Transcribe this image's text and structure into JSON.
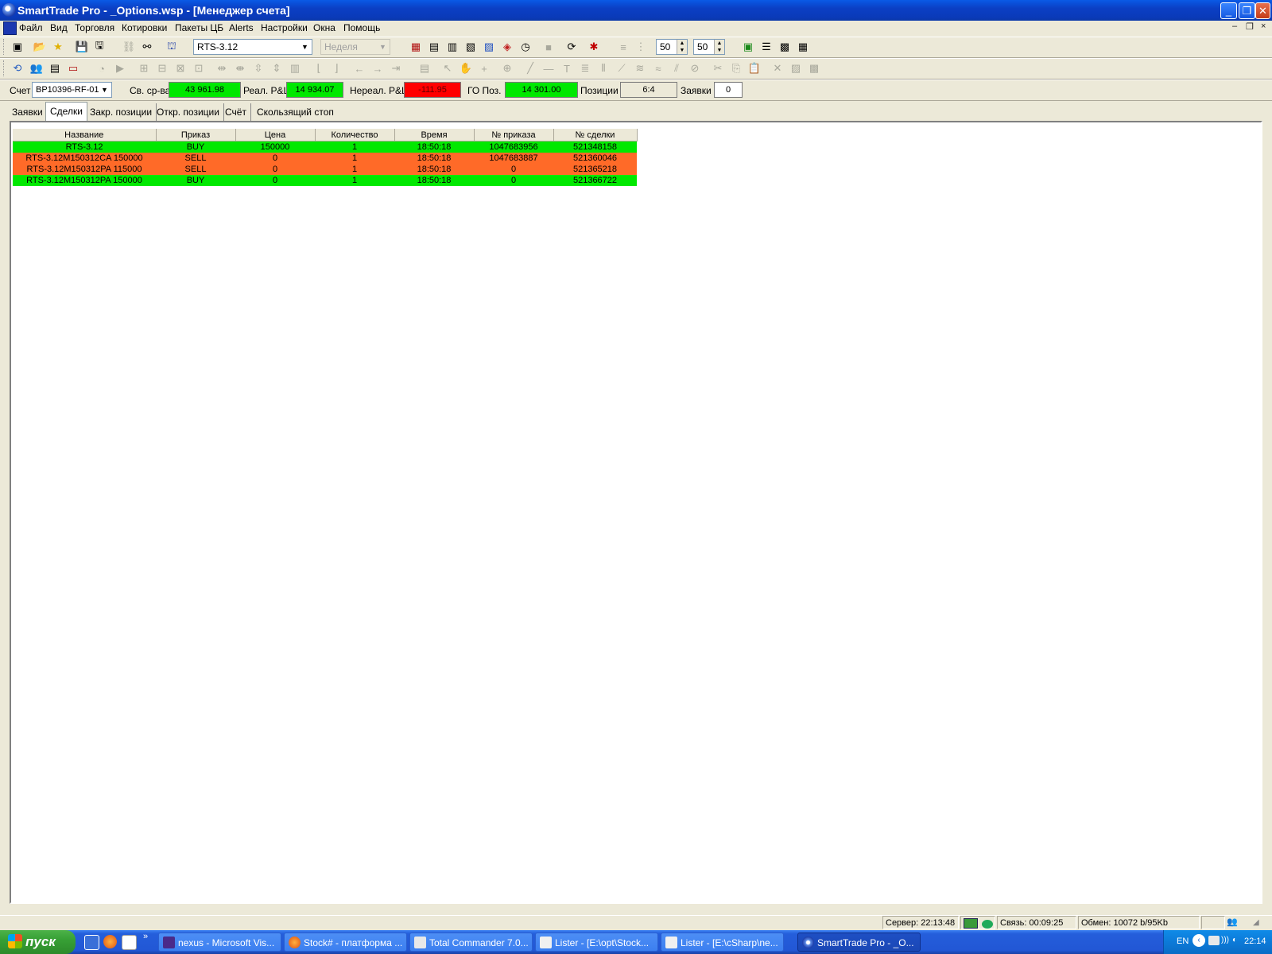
{
  "window": {
    "title": "SmartTrade Pro - _Options.wsp - [Менеджер счета]",
    "controls": [
      "_",
      "❐",
      "✕"
    ],
    "mdi_controls": [
      "–",
      "❐",
      "×"
    ]
  },
  "menu": [
    "Файл",
    "Вид",
    "Торговля",
    "Котировки",
    "Пакеты ЦБ",
    "Alerts",
    "Настройки",
    "Окна",
    "Помощь"
  ],
  "toolbar": {
    "symbol": "RTS-3.12",
    "period": "Неделя",
    "spin1": "50",
    "spin2": "50"
  },
  "account": {
    "account_label": "Счет",
    "account_value": "BP10396-RF-01",
    "free_funds_label": "Св. ср-ва",
    "free_funds_value": "43 961.98",
    "realized_label": "Реал. P&L",
    "realized_value": "14 934.07",
    "unrealized_label": "Нереал. P&L",
    "unrealized_value": "-111.95",
    "margin_label": "ГО Поз.",
    "margin_value": "14 301.00",
    "positions_label": "Позиции",
    "positions_value": "6:4",
    "orders_label": "Заявки",
    "orders_value": "0"
  },
  "tabs": [
    "Заявки",
    "Сделки",
    "Закр. позиции",
    "Откр. позиции",
    "Счёт",
    "Скользящий стоп"
  ],
  "active_tab": "Сделки",
  "table": {
    "headers": [
      "Название",
      "Приказ",
      "Цена",
      "Количество",
      "Время",
      "№ приказа",
      "№ сделки"
    ],
    "rows": [
      {
        "side": "buy",
        "cells": [
          "RTS-3.12",
          "BUY",
          "150000",
          "1",
          "18:50:18",
          "1047683956",
          "521348158"
        ]
      },
      {
        "side": "sell",
        "cells": [
          "RTS-3.12M150312CA 150000",
          "SELL",
          "0",
          "1",
          "18:50:18",
          "1047683887",
          "521360046"
        ]
      },
      {
        "side": "sell",
        "cells": [
          "RTS-3.12M150312PA 115000",
          "SELL",
          "0",
          "1",
          "18:50:18",
          "0",
          "521365218"
        ]
      },
      {
        "side": "buy",
        "cells": [
          "RTS-3.12M150312PA 150000",
          "BUY",
          "0",
          "1",
          "18:50:18",
          "0",
          "521366722"
        ]
      }
    ]
  },
  "status": {
    "server": "Сервер: 22:13:48",
    "connection": "Связь: 00:09:25",
    "exchange": "Обмен: 10072 b/95Kb"
  },
  "taskbar": {
    "start": "пуск",
    "tasks": [
      "nexus - Microsoft Vis...",
      "Stock# - платформа ...",
      "Total Commander 7.0...",
      "Lister - [E:\\opt\\Stock...",
      "Lister - [E:\\cSharp\\ne...",
      "SmartTrade Pro - _O..."
    ],
    "lang": "EN",
    "clock": "22:14"
  },
  "colors": {
    "buy": "#00e800",
    "sell": "#ff6a28",
    "negative": "#ff0000"
  }
}
